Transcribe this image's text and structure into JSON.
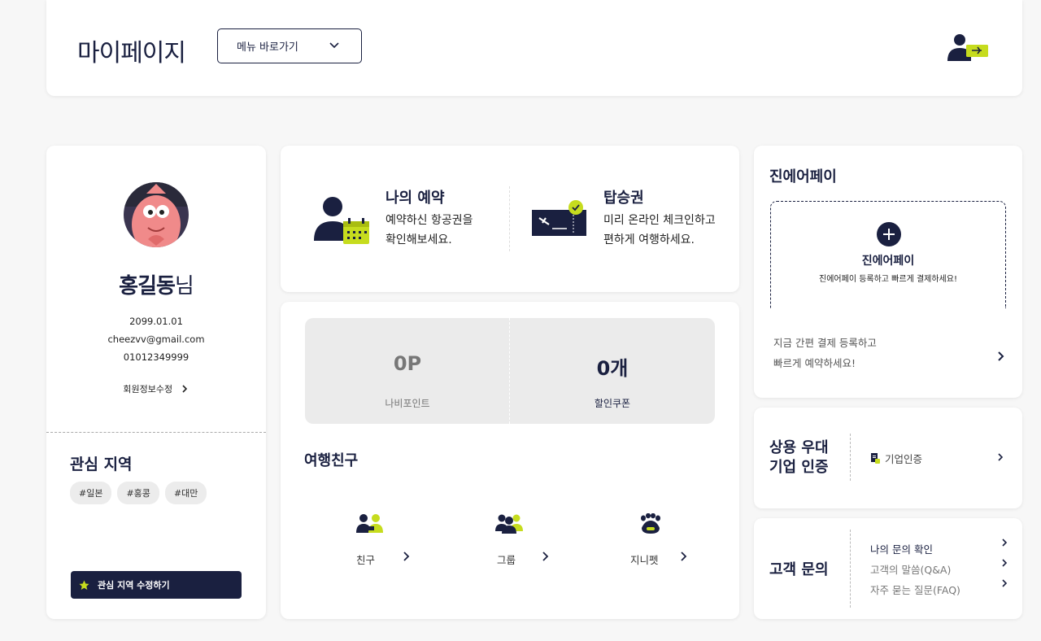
{
  "header": {
    "title": "마이페이지",
    "menu_select": "메뉴 바로가기"
  },
  "profile": {
    "name": "홍길동",
    "honorific": "님",
    "birth": "2099.01.01",
    "email": "cheezvv@gmail.com",
    "phone": "01012349999",
    "edit_label": "회원정보수정",
    "interest_title": "관심 지역",
    "tags": [
      "#일본",
      "#홍콩",
      "#대만"
    ],
    "edit_interest_label": "관심 지역 수정하기"
  },
  "reservation": {
    "title": "나의 예약",
    "desc1": "예약하신 항공권을",
    "desc2": "확인해보세요.",
    "boarding_title": "탑승권",
    "boarding_desc1": "미리 온라인 체크인하고",
    "boarding_desc2": "편하게 여행하세요."
  },
  "points": {
    "navi_value": "0P",
    "navi_label": "나비포인트",
    "coupon_value": "0개",
    "coupon_label": "할인쿠폰"
  },
  "friends": {
    "title": "여행친구",
    "items": [
      {
        "label": "친구"
      },
      {
        "label": "그룹"
      },
      {
        "label": "지니펫"
      }
    ]
  },
  "pay": {
    "title": "진에어페이",
    "box_title": "진에어페이",
    "box_desc": "진에어페이 등록하고 빠르게 결제하세요!",
    "promo1": "지금 간편 결제 등록하고",
    "promo2": "빠르게 예약하세요!"
  },
  "corporate": {
    "title1": "상용 우대",
    "title2": "기업 인증",
    "link": "기업인증"
  },
  "inquiry": {
    "title": "고객 문의",
    "items": [
      "나의 문의 확인",
      "고객의 말씀(Q&A)",
      "자주 묻는 질문(FAQ)"
    ]
  },
  "colors": {
    "navy": "#1a2040",
    "lime": "#c6dc1e"
  }
}
